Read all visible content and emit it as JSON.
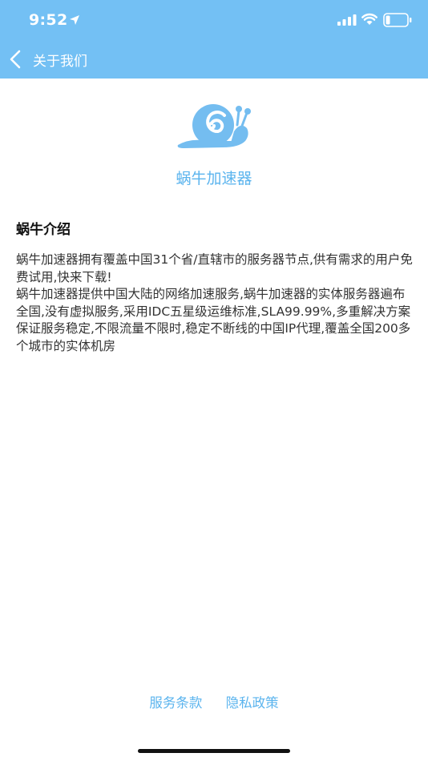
{
  "status_bar": {
    "time": "9:52"
  },
  "nav": {
    "title": "关于我们"
  },
  "app": {
    "name": "蜗牛加速器"
  },
  "intro": {
    "heading": "蜗牛介绍",
    "paragraphs": [
      "蜗牛加速器拥有覆盖中国31个省/直辖市的服务器节点,供有需求的用户免费试用,快来下载!",
      "蜗牛加速器提供中国大陆的网络加速服务,蜗牛加速器的实体服务器遍布全国,没有虚拟服务,采用IDC五星级运维标准,SLA99.99%,多重解决方案保证服务稳定,不限流量不限时,稳定不断线的中国IP代理,覆盖全国200多个城市的实体机房"
    ]
  },
  "footer": {
    "terms": "服务条款",
    "privacy": "隐私政策"
  },
  "icons": {
    "back": "chevron-left-icon",
    "logo": "snail-logo-icon",
    "location": "location-arrow-icon",
    "signal": "cellular-signal-icon",
    "wifi": "wifi-icon",
    "battery": "battery-icon"
  },
  "colors": {
    "header": "#73c0f4",
    "accent": "#5bb4ee",
    "logo": "#74bdf0"
  }
}
